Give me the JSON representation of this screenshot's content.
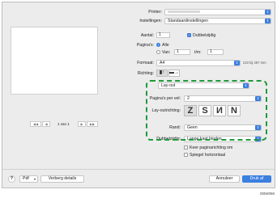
{
  "printer": {
    "label": "Printer:",
    "value": ""
  },
  "presets": {
    "label": "Instellingen:",
    "value": "Standaardinstellingen"
  },
  "copies": {
    "label": "Aantal:",
    "value": "1",
    "duplex_label": "Dubbelzijdig"
  },
  "pages": {
    "label": "Pagina's:",
    "all_label": "Alle",
    "from_label": "Van:",
    "from_value": "1",
    "to_label": "t/m:",
    "to_value": "1"
  },
  "paper": {
    "label": "Formaat:",
    "value": "A4",
    "size_text": "210 bij 297 mm"
  },
  "orientation": {
    "label": "Richting:"
  },
  "preview_nav": {
    "page_text": "1 van 1",
    "first": "◀◀",
    "prev": "◀",
    "next": "▶",
    "last": "▶▶"
  },
  "section": {
    "value": "Lay-out"
  },
  "pages_per_sheet": {
    "label": "Pagina's per vel:",
    "value": "2"
  },
  "layout_direction": {
    "label": "Lay-outrichting:",
    "options": [
      "Z",
      "S",
      "И",
      "N"
    ]
  },
  "border": {
    "label": "Rand:",
    "value": "Geen"
  },
  "two_sided": {
    "label": "Dubbelzijdig:",
    "value": "Lange kant binden"
  },
  "reverse": {
    "label": "Keer paginarichting om"
  },
  "mirror": {
    "label": "Spiegel horizontaal"
  },
  "footer": {
    "help": "?",
    "pdf": "Pdf",
    "details": "Verberg details",
    "cancel": "Annuleer",
    "print": "Druk af"
  },
  "figure_code": "EBW066"
}
